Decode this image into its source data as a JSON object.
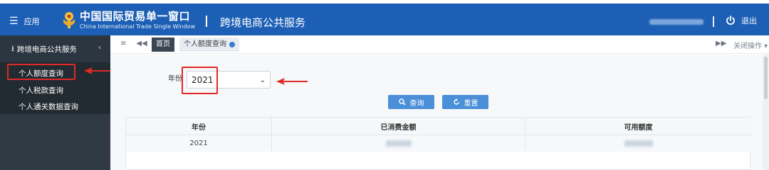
{
  "header": {
    "menu_label": "应用",
    "brand_cn": "中国国际贸易单一窗口",
    "brand_en": "China International Trade Single Window",
    "service_title": "跨境电商公共服务",
    "logout_label": "退出"
  },
  "sidebar": {
    "section_title": "跨境电商公共服务",
    "items": [
      {
        "label": "个人额度查询"
      },
      {
        "label": "个人税款查询"
      },
      {
        "label": "个人通关数据查询"
      }
    ]
  },
  "tabs": {
    "home": "首页",
    "current": "个人额度查询",
    "close_ops": "关闭操作"
  },
  "form": {
    "year_label": "年份",
    "year_value": "2021",
    "query_button": "查询",
    "reset_button": "重置"
  },
  "table": {
    "headers": [
      "年份",
      "已消费金额",
      "可用额度"
    ],
    "rows": [
      {
        "year": "2021"
      }
    ]
  },
  "colors": {
    "header_bg": "#1c5fb5",
    "sidebar_bg": "#2f3a45",
    "button_bg": "#4b8fd8",
    "annotation_red": "#e02a25"
  }
}
